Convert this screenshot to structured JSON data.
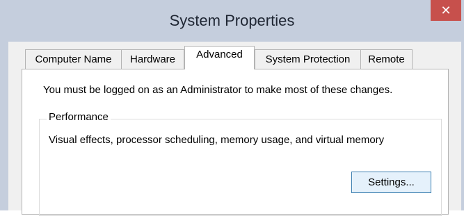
{
  "window": {
    "title": "System Properties",
    "close_glyph": "✕"
  },
  "tabs": [
    {
      "label": "Computer Name",
      "active": false
    },
    {
      "label": "Hardware",
      "active": false
    },
    {
      "label": "Advanced",
      "active": true
    },
    {
      "label": "System Protection",
      "active": false
    },
    {
      "label": "Remote",
      "active": false
    }
  ],
  "advanced": {
    "notice": "You must be logged on as an Administrator to make most of these changes.",
    "performance": {
      "legend": "Performance",
      "description": "Visual effects, processor scheduling, memory usage, and virtual memory",
      "settings_button": "Settings..."
    }
  },
  "colors": {
    "titlebar": "#c5cedd",
    "close": "#c7504c",
    "button_accent": "#3c7fb1"
  }
}
